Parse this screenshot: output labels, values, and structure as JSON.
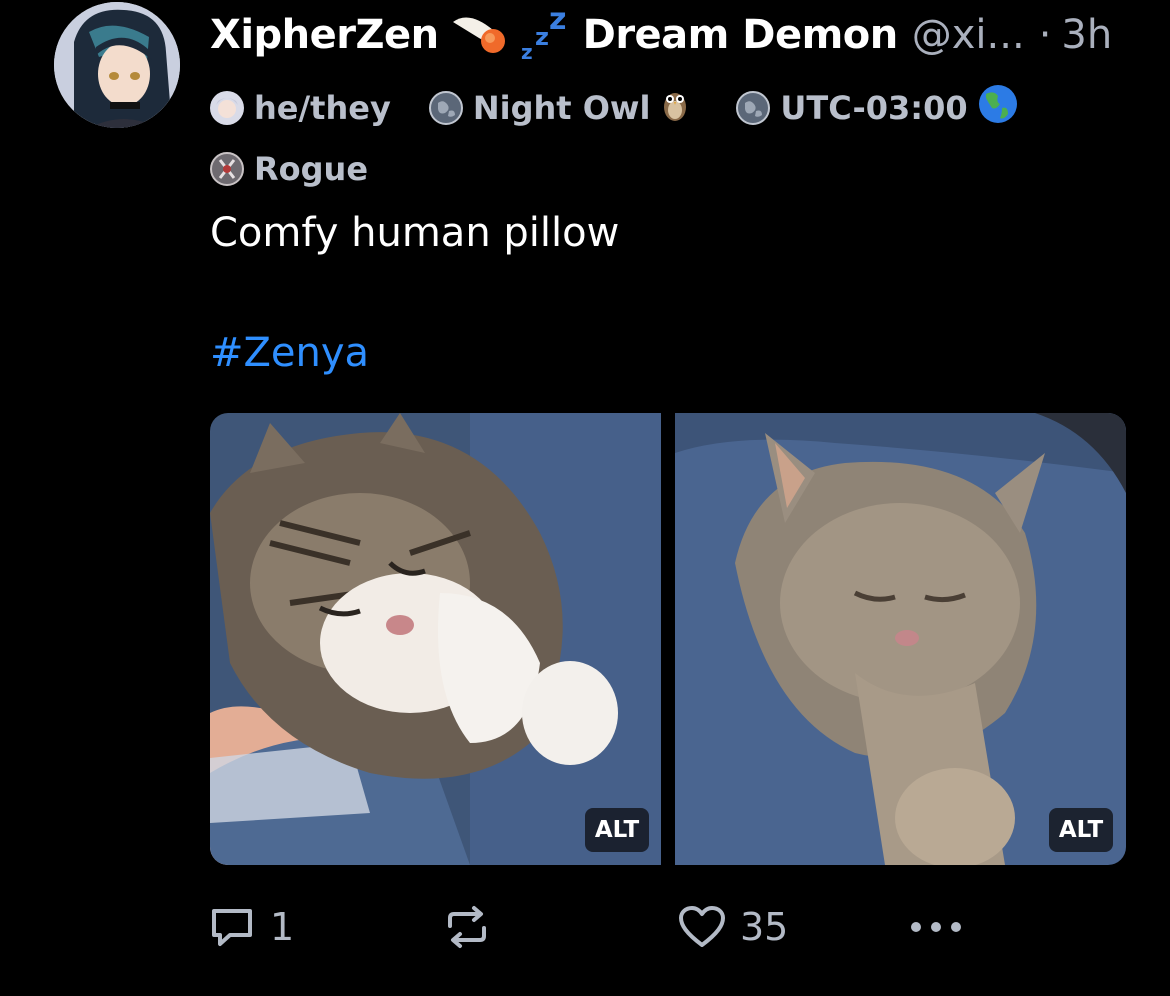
{
  "post": {
    "author": {
      "display_name": "XipherZen",
      "display_title": "Dream Demon",
      "handle": "@xi...",
      "separator": "·",
      "time_ago": "3h",
      "avatar_icon": "anime-avatar-icon"
    },
    "badges": [
      {
        "icon": "anime-girl-icon",
        "label": "he/they"
      },
      {
        "icon": "globe-badge-icon",
        "label": "Night Owl",
        "emoji_icon": "owl-icon"
      },
      {
        "icon": "globe-badge-icon",
        "label": "UTC-03:00",
        "emoji_icon": "earth-americas-icon"
      },
      {
        "icon": "rogue-badge-icon",
        "label": "Rogue"
      }
    ],
    "text": "Comfy human pillow",
    "hashtag": "#Zenya",
    "images": [
      {
        "alt_label": "ALT",
        "subject": "tabby-white-cat"
      },
      {
        "alt_label": "ALT",
        "subject": "gray-fluffy-cat"
      }
    ],
    "actions": {
      "reply_count": "1",
      "repost_count": "",
      "like_count": "35",
      "more_icon": "ellipsis-icon"
    }
  },
  "colors": {
    "background": "#000000",
    "text": "#ffffff",
    "muted": "#b3bac6",
    "hashtag": "#2f8fff"
  }
}
